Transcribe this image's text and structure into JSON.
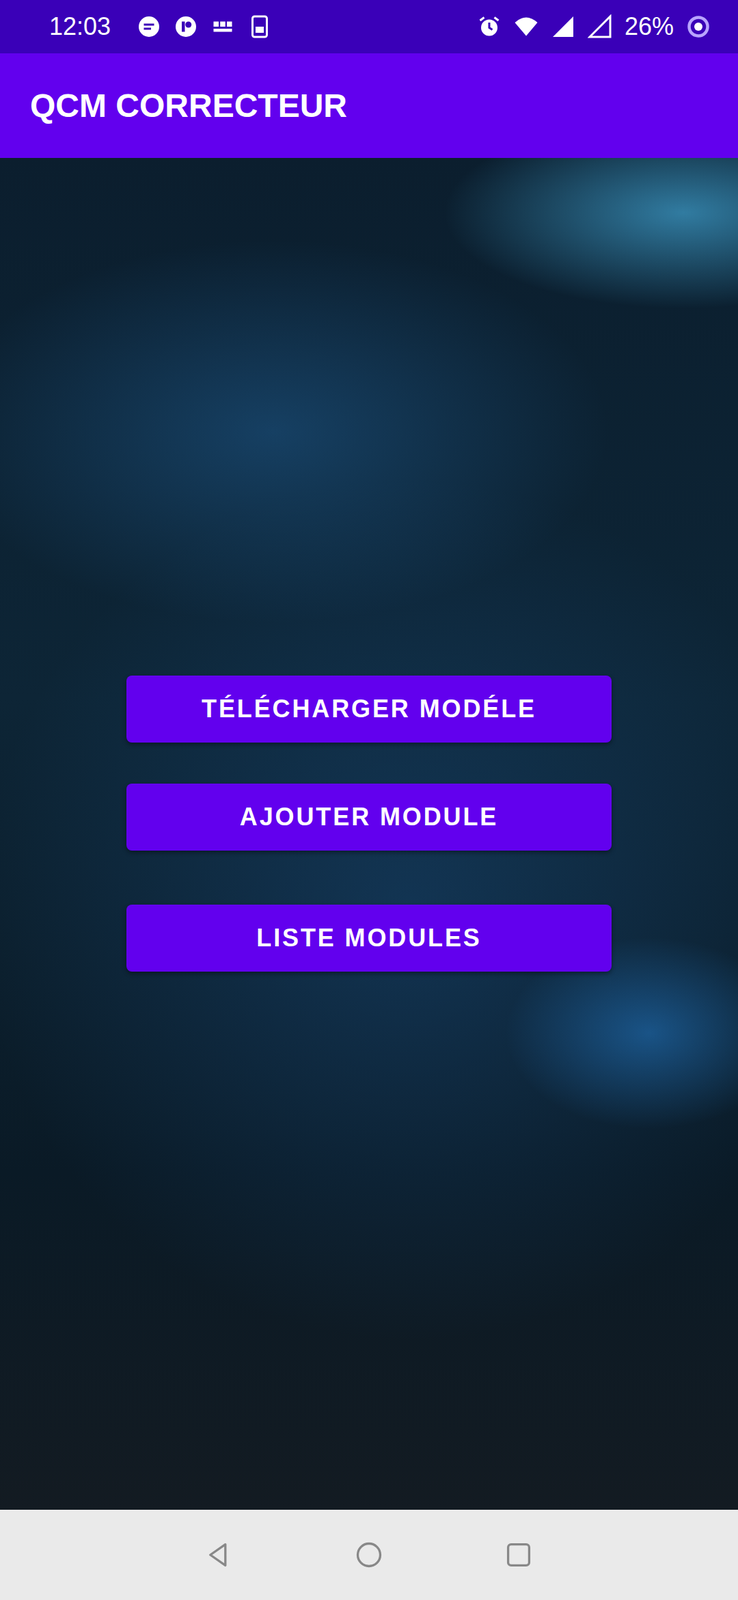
{
  "status_bar": {
    "time": "12:03",
    "battery": "26%"
  },
  "app_bar": {
    "title": "QCM CORRECTEUR"
  },
  "buttons": [
    {
      "label": "TÉLÉCHARGER MODÉLE"
    },
    {
      "label": "AJOUTER MODULE"
    },
    {
      "label": "LISTE MODULES"
    }
  ]
}
